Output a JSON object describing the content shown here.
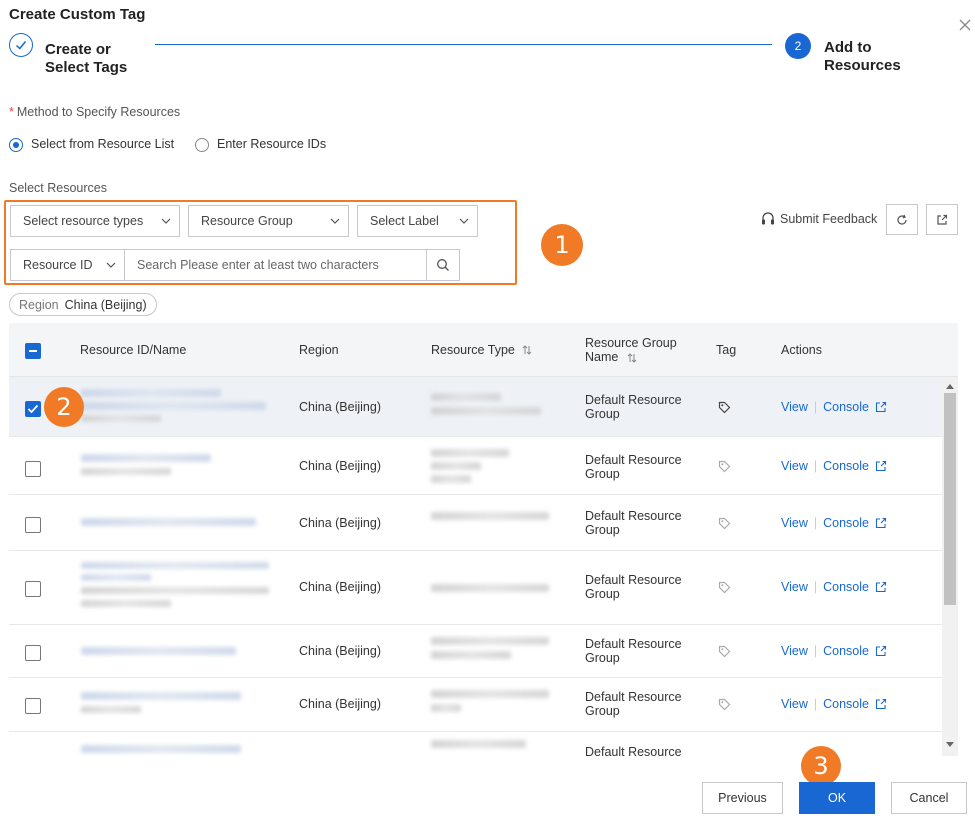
{
  "dialog": {
    "title": "Create Custom Tag"
  },
  "steps": [
    {
      "label": "Create or Select Tags"
    },
    {
      "number": "2",
      "label": "Add to Resources"
    }
  ],
  "method": {
    "label": "Method to Specify Resources",
    "required_mark": "*",
    "options": [
      "Select from Resource List",
      "Enter Resource IDs"
    ],
    "selected": "Select from Resource List"
  },
  "select_resources": {
    "label": "Select Resources"
  },
  "filters": {
    "resource_types": "Select resource types",
    "resource_group": "Resource Group",
    "select_label": "Select Label",
    "resource_id": "Resource ID",
    "search_placeholder": "Search Please enter at least two characters"
  },
  "toolbar": {
    "submit_feedback": "Submit Feedback"
  },
  "region_tag": {
    "key": "Region",
    "value": "China (Beijing)"
  },
  "table": {
    "columns": [
      "Resource ID/Name",
      "Region",
      "Resource Type",
      "Resource Group Name",
      "Tag",
      "Actions"
    ],
    "rows": [
      {
        "region": "China (Beijing)",
        "group": "Default Resource Group",
        "checked": true
      },
      {
        "region": "China (Beijing)",
        "group": "Default Resource Group",
        "checked": false
      },
      {
        "region": "China (Beijing)",
        "group": "Default Resource Group",
        "checked": false
      },
      {
        "region": "China (Beijing)",
        "group": "Default Resource Group",
        "checked": false
      },
      {
        "region": "China (Beijing)",
        "group": "Default Resource Group",
        "checked": false
      },
      {
        "region": "China (Beijing)",
        "group": "Default Resource Group",
        "checked": false
      },
      {
        "region": "",
        "group": "Default Resource",
        "checked": false
      }
    ],
    "action_view": "View",
    "action_console": "Console"
  },
  "badges": [
    "1",
    "2",
    "3"
  ],
  "footer": {
    "previous": "Previous",
    "ok": "OK",
    "cancel": "Cancel"
  },
  "colors": {
    "primary": "#1967d2",
    "annotation": "#f07a26"
  }
}
